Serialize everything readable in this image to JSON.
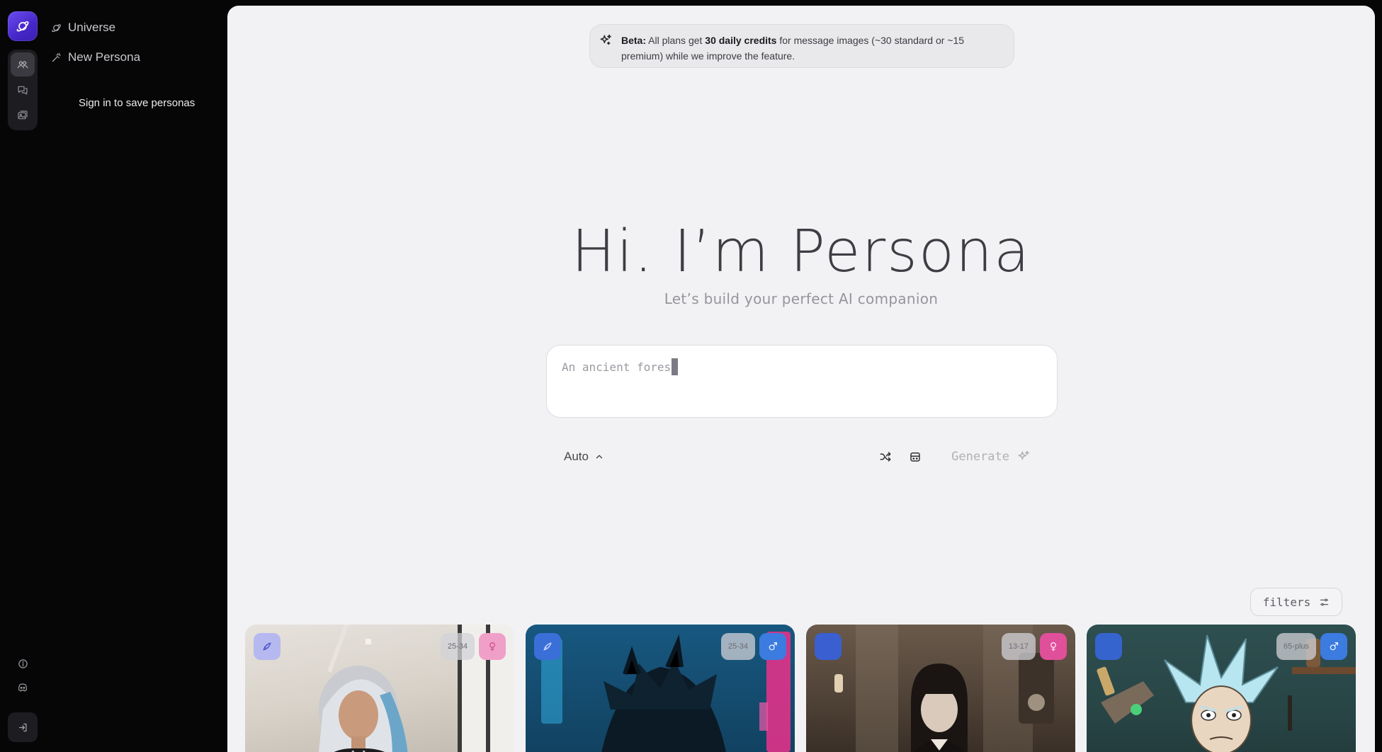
{
  "sidebar": {
    "nav": [
      {
        "label": "Universe",
        "icon": "planet-icon"
      },
      {
        "label": "New Persona",
        "icon": "magic-wand-icon"
      }
    ],
    "signin_note": "Sign in to save personas",
    "rail_icons": [
      "personas-icon",
      "chat-icon",
      "gallery-icon"
    ],
    "bottom_icons": [
      "info-icon",
      "discord-icon"
    ],
    "signin_icon": "sign-in-icon"
  },
  "beta_banner": {
    "prefix": "Beta:",
    "part1": " All plans get ",
    "credits": "30 daily credits",
    "part2": " for message images (~30 standard or ~15 premium) while we improve the feature."
  },
  "hero": {
    "title": "Hi. I’m Persona",
    "subtitle": "Let’s build your perfect AI companion"
  },
  "prompt": {
    "value": "An ancient fores"
  },
  "toolbar": {
    "mode_label": "Auto",
    "generate_label": "Generate"
  },
  "filters_label": "filters",
  "cards": [
    {
      "age": "25-34",
      "gender": "female",
      "accent": "#b6b8f0",
      "gender_color": "#f0a0c8"
    },
    {
      "age": "25-34",
      "gender": "male",
      "accent": "#3a6fd8",
      "gender_color": "#3c7be0"
    },
    {
      "age": "13-17",
      "gender": "female",
      "accent": "#3a5fd0",
      "gender_color": "#e04f9a"
    },
    {
      "age": "65-plus",
      "gender": "male",
      "accent": "#3564cf",
      "gender_color": "#3c7be0"
    }
  ],
  "colors": {
    "brand": "#5b3ee6",
    "main_bg": "#f2f2f4",
    "sidebar_bg": "#060607"
  }
}
